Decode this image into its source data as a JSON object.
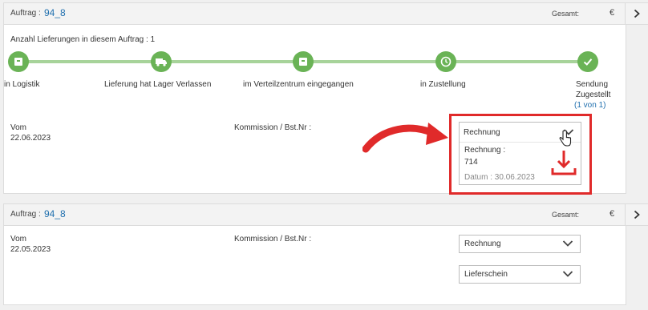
{
  "orders": [
    {
      "header": {
        "auftrag_label": "Auftrag :",
        "auftrag_value": "94_8",
        "gesamt_label": "Gesamt:",
        "currency": "€"
      },
      "delivery_count": "Anzahl Lieferungen in diesem Auftrag : 1",
      "steps": [
        {
          "label": "in Logistik",
          "icon": "box-icon"
        },
        {
          "label": "Lieferung hat Lager Verlassen",
          "icon": "truck-icon"
        },
        {
          "label": "im Verteilzentrum eingegangen",
          "icon": "box-icon"
        },
        {
          "label": "in Zustellung",
          "icon": "clock-icon"
        },
        {
          "label_line1": "Sendung",
          "label_line2": "Zugestellt",
          "label_line3": "(1 von 1)",
          "icon": "check-icon"
        }
      ],
      "vom_label": "Vom",
      "vom_date": "22.06.2023",
      "kommission_label": "Kommission / Bst.Nr :",
      "rechnung_dropdown": "Rechnung",
      "invoice": {
        "label": "Rechnung :",
        "number": "714",
        "date": "Datum : 30.06.2023"
      }
    },
    {
      "header": {
        "auftrag_label": "Auftrag :",
        "auftrag_value": "94_8",
        "gesamt_label": "Gesamt:",
        "currency": "€"
      },
      "vom_label": "Vom",
      "vom_date": "22.05.2023",
      "kommission_label": "Kommission / Bst.Nr :",
      "rechnung_dropdown": "Rechnung",
      "lieferschein_dropdown": "Lieferschein"
    }
  ],
  "colors": {
    "accent": "#1f6fae",
    "step_green": "#6ab356",
    "line_green": "#a7d39a",
    "highlight_red": "#e02a2a"
  }
}
